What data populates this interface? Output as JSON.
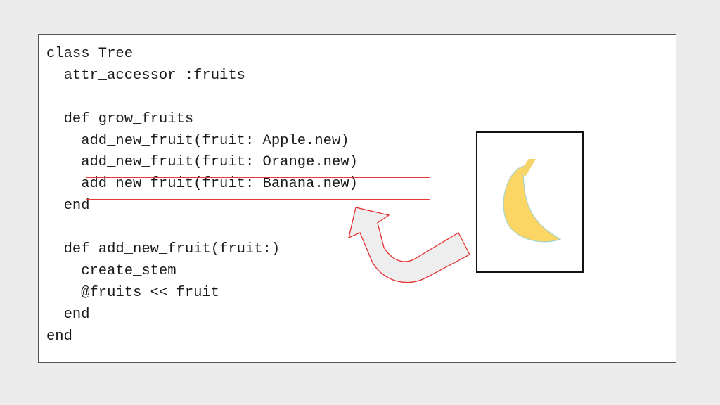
{
  "code": {
    "lines": [
      "class Tree",
      "  attr_accessor :fruits",
      "",
      "  def grow_fruits",
      "    add_new_fruit(fruit: Apple.new)",
      "    add_new_fruit(fruit: Orange.new)",
      "    add_new_fruit(fruit: Banana.new)",
      "  end",
      "",
      "  def add_new_fruit(fruit:)",
      "    create_stem",
      "    @fruits << fruit",
      "  end",
      "end"
    ],
    "highlighted_line_index": 6
  },
  "colors": {
    "background": "#ececec",
    "panel": "#ffffff",
    "highlight_border": "#e23a3a",
    "arrow_fill": "#eeeeee",
    "banana_fill": "#fbd665",
    "banana_tip": "#f6d46a",
    "banana_edge": "#a9d3c9"
  },
  "icons": {
    "arrow": "curved-arrow-icon",
    "fruit": "banana-icon"
  }
}
